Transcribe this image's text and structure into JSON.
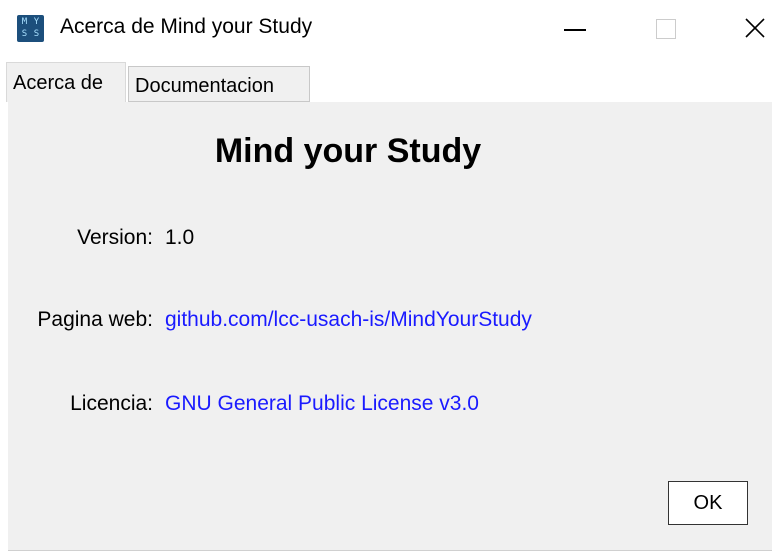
{
  "window": {
    "title": "Acerca de Mind your Study",
    "app_icon": "mind-your-study-icon"
  },
  "tabs": [
    {
      "label": "Acerca de",
      "active": true
    },
    {
      "label": "Documentacion",
      "active": false
    }
  ],
  "about": {
    "app_name": "Mind your Study",
    "version_label": "Version:",
    "version_value": "1.0",
    "website_label": "Pagina web:",
    "website_value": "github.com/lcc-usach-is/MindYourStudy",
    "license_label": "Licencia:",
    "license_value": "GNU General Public License v3.0"
  },
  "buttons": {
    "ok_label": "OK"
  },
  "colors": {
    "link": "#1a1aff",
    "panel_bg": "#f0f0f0"
  }
}
